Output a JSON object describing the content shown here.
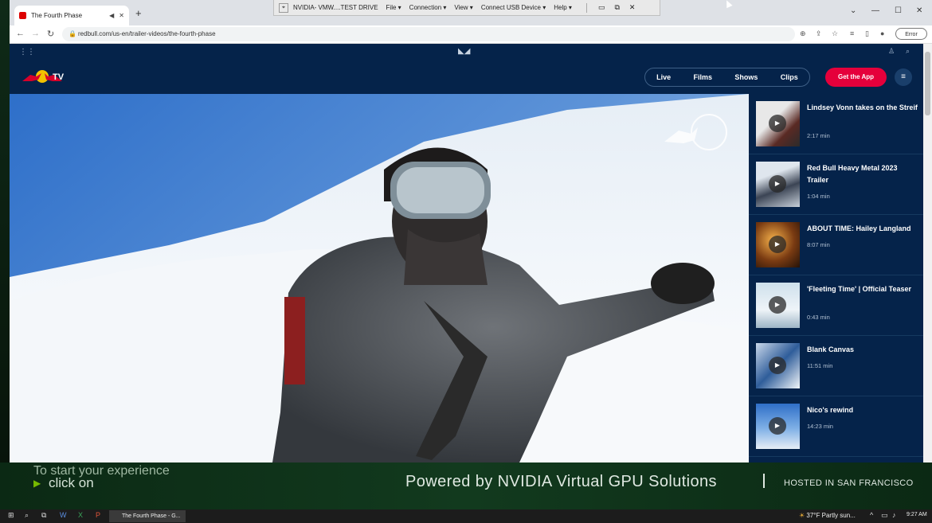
{
  "browser": {
    "tab_title": "The Fourth Phase",
    "url": "redbull.com/us-en/trailer-videos/the-fourth-phase",
    "error_label": "Error"
  },
  "remote_toolbar": {
    "title": "NVIDIA- VMW....TEST DRIVE",
    "menus": [
      "File ▾",
      "Connection ▾",
      "View ▾",
      "Connect USB Device ▾",
      "Help ▾"
    ]
  },
  "site": {
    "logo_text": "TV",
    "nav": [
      "Live",
      "Films",
      "Shows",
      "Clips"
    ],
    "cta": "Get the App"
  },
  "playlist": [
    {
      "title": "Lindsey Vonn takes on the Streif",
      "duration": "2:17 min"
    },
    {
      "title": "Red Bull Heavy Metal 2023 Trailer",
      "duration": "1:04 min"
    },
    {
      "title": "ABOUT TIME: Hailey Langland",
      "duration": "8:07 min"
    },
    {
      "title": "'Fleeting Time' | Official Teaser",
      "duration": "0:43 min"
    },
    {
      "title": "Blank Canvas",
      "duration": "11:51 min"
    },
    {
      "title": "Nico's rewind",
      "duration": "14:23 min"
    }
  ],
  "banner": {
    "line1": "To start your experience",
    "line2": "click on",
    "main": "Powered by NVIDIA Virtual GPU Solutions",
    "hosted": "HOSTED IN SAN FRANCISCO"
  },
  "taskbar": {
    "app_label": "The Fourth Phase - G...",
    "weather": "37°F  Partly sun...",
    "time": "9:27 AM"
  }
}
